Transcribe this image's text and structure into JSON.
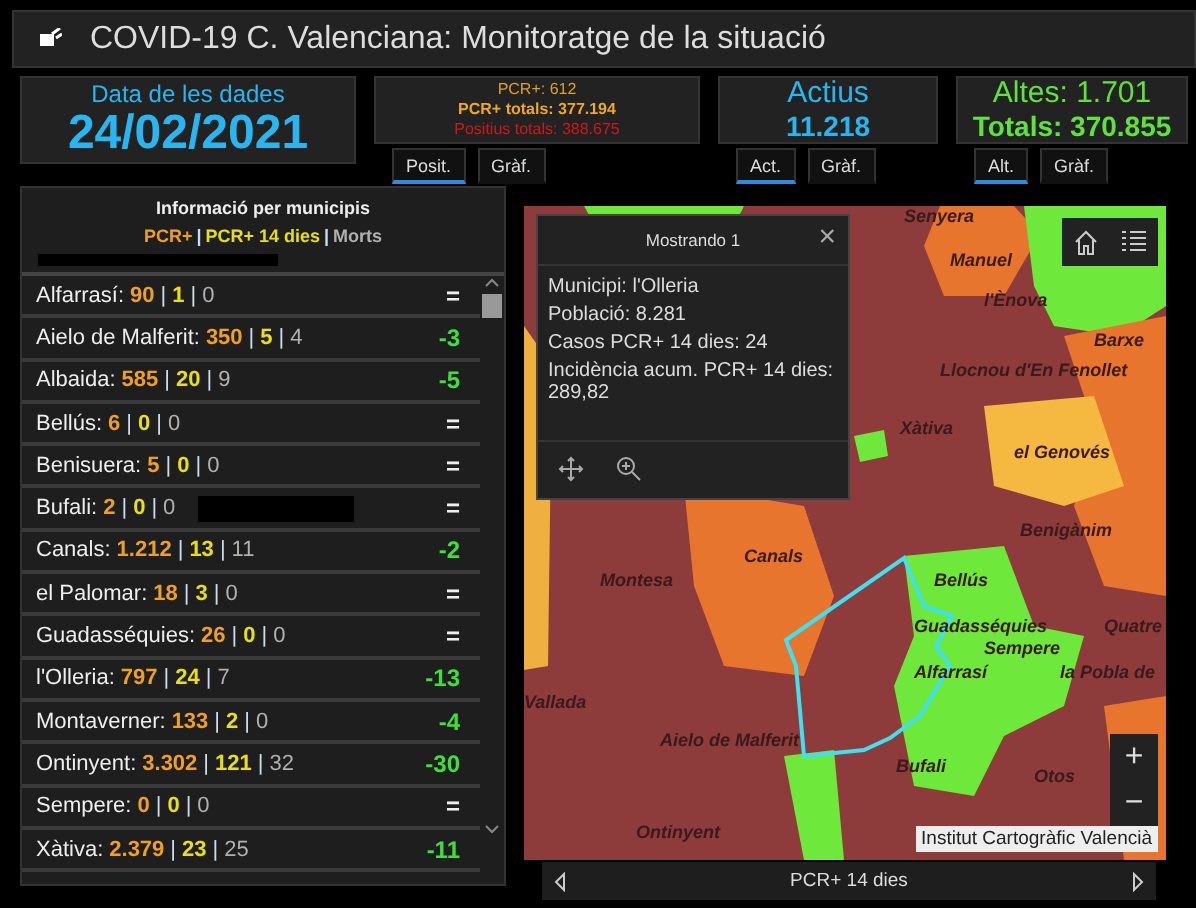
{
  "window": {
    "title": "COVID-19 C. Valenciana: Monitoratge de la situació"
  },
  "date_card": {
    "label": "Data de les dades",
    "value": "24/02/2021"
  },
  "cards": [
    {
      "kind": "lines",
      "lines": [
        {
          "text": "PCR+: 612",
          "color": "#e0a020"
        },
        {
          "text": "PCR+ totals: 377.194",
          "color": "#f0a820"
        },
        {
          "text": "Positius totals: 388.675",
          "color": "#d01818"
        }
      ],
      "tabs": [
        {
          "label": "Posit.",
          "selected": true
        },
        {
          "label": "Gràf.",
          "selected": false
        }
      ]
    },
    {
      "kind": "stat",
      "title": "Actius",
      "value": "11.218",
      "color": "#29b6f0",
      "tabs": [
        {
          "label": "Act.",
          "selected": true
        },
        {
          "label": "Gràf.",
          "selected": false
        }
      ]
    },
    {
      "kind": "stat",
      "title": "Altes: 1.701",
      "value": "Totals: 370.855",
      "color": "#5fe23a",
      "tabs": [
        {
          "label": "Alt.",
          "selected": true
        },
        {
          "label": "Gràf.",
          "selected": false
        }
      ]
    }
  ],
  "municipalities": {
    "title": "Informació per municipis",
    "legend": [
      {
        "text": "PCR+",
        "color": "#f0a020"
      },
      {
        "text": "PCR+ 14 dies",
        "color": "#e8e010"
      },
      {
        "text": "Morts",
        "color": "#b0b0b0"
      }
    ],
    "separator": "|",
    "redacted": true,
    "rows": [
      {
        "name": "Alfarrasí:",
        "pcr": "90",
        "pcr14": "1",
        "deaths": "0",
        "change": "=",
        "color": "#eeeeee",
        "redacted": false
      },
      {
        "name": "Aielo de Malferit:",
        "pcr": "350",
        "pcr14": "5",
        "deaths": "4",
        "change": "-3",
        "color": "#3ee03a",
        "redacted": false
      },
      {
        "name": "Albaida:",
        "pcr": "585",
        "pcr14": "20",
        "deaths": "9",
        "change": "-5",
        "color": "#3ee03a",
        "redacted": false
      },
      {
        "name": "Bellús:",
        "pcr": "6",
        "pcr14": "0",
        "deaths": "0",
        "change": "=",
        "color": "#eeeeee",
        "redacted": false
      },
      {
        "name": "Benisuera:",
        "pcr": "5",
        "pcr14": "0",
        "deaths": "0",
        "change": "=",
        "color": "#eeeeee",
        "redacted": false
      },
      {
        "name": "Bufali:",
        "pcr": "2",
        "pcr14": "0",
        "deaths": "0",
        "change": "=",
        "color": "#eeeeee",
        "redacted": true
      },
      {
        "name": "Canals:",
        "pcr": "1.212",
        "pcr14": "13",
        "deaths": "11",
        "change": "-2",
        "color": "#3ee03a",
        "redacted": false
      },
      {
        "name": "el Palomar:",
        "pcr": "18",
        "pcr14": "3",
        "deaths": "0",
        "change": "=",
        "color": "#eeeeee",
        "redacted": false
      },
      {
        "name": "Guadasséquies:",
        "pcr": "26",
        "pcr14": "0",
        "deaths": "0",
        "change": "=",
        "color": "#eeeeee",
        "redacted": false
      },
      {
        "name": "l'Olleria:",
        "pcr": "797",
        "pcr14": "24",
        "deaths": "7",
        "change": "-13",
        "color": "#3ee03a",
        "redacted": false
      },
      {
        "name": "Montaverner:",
        "pcr": "133",
        "pcr14": "2",
        "deaths": "0",
        "change": "-4",
        "color": "#3ee03a",
        "redacted": false
      },
      {
        "name": "Ontinyent:",
        "pcr": "3.302",
        "pcr14": "121",
        "deaths": "32",
        "change": "-30",
        "color": "#3ee03a",
        "redacted": false
      },
      {
        "name": "Sempere:",
        "pcr": "0",
        "pcr14": "0",
        "deaths": "0",
        "change": "=",
        "color": "#eeeeee",
        "redacted": false
      },
      {
        "name": "Xàtiva:",
        "pcr": "2.379",
        "pcr14": "23",
        "deaths": "25",
        "change": "-11",
        "color": "#3ee03a",
        "redacted": false
      }
    ]
  },
  "map": {
    "labels": [
      "Senyera",
      "Manuel",
      "l'Ènova",
      "Barxe",
      "Llocnou d'En Fenollet",
      "Xàtiva",
      "el Genovés",
      "Benigànim",
      "Canals",
      "Montesa",
      "Bellús",
      "Guadasséquies",
      "Sempere",
      "Quatre",
      "Alfarrasí",
      "la Pobla de",
      "Vallada",
      "Aielo de Malferit",
      "Bufali",
      "Otos",
      "Ontinyent"
    ],
    "attribution": "Institut Cartogràfic Valencià",
    "popup": {
      "title": "Mostrando 1",
      "close": "×",
      "lines": [
        "Municipi: l'Olleria",
        "Població: 8.281",
        "Casos PCR+ 14 dies: 24",
        "Incidència acum. PCR+ 14 dies: 289,82"
      ]
    },
    "zoom_in": "+",
    "zoom_out": "−",
    "layer_label": "PCR+ 14 dies"
  }
}
